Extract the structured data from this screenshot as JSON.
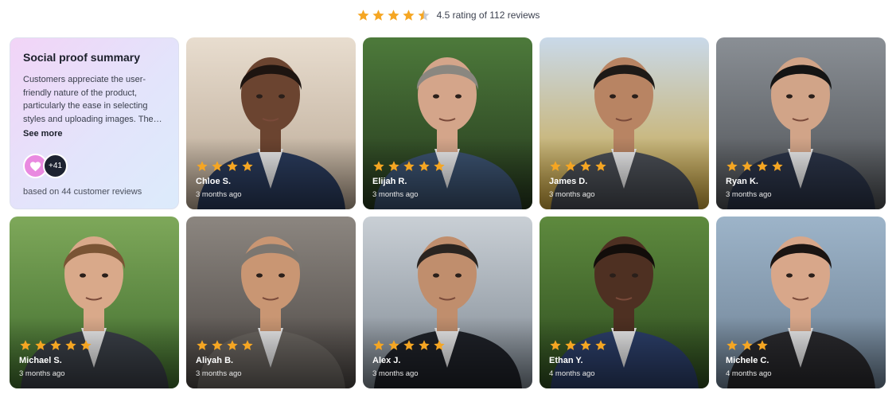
{
  "rating": {
    "stars": 4.5,
    "text": "4.5 rating of 112 reviews"
  },
  "summary": {
    "title": "Social proof summary",
    "body": "Customers appreciate the user-friendly nature of the product, particularly the ease in selecting styles and uploading images. The…",
    "see_more": "See more",
    "extra_count": "+41",
    "based_on": "based on 44 customer reviews"
  },
  "colors": {
    "star": "#f5a623",
    "accent_pink": "#e98ae0",
    "dark": "#1d2230"
  },
  "reviews": [
    {
      "name": "Chloe S.",
      "time": "3 months ago",
      "stars": 4,
      "bg": [
        "#e8ddcf",
        "#b7a591"
      ],
      "skin": "#6b4430",
      "suit": "#2a3b5c",
      "hair": "#1d1410"
    },
    {
      "name": "Elijah R.",
      "time": "3 months ago",
      "stars": 5,
      "bg": [
        "#4d7a3b",
        "#24361c"
      ],
      "skin": "#d4a58a",
      "suit": "#3b5270",
      "hair": "#8a8780"
    },
    {
      "name": "James D.",
      "time": "3 months ago",
      "stars": 4,
      "bg": [
        "#c9d9e9",
        "#c9a23a"
      ],
      "skin": "#b88463",
      "suit": "#4a4e55",
      "hair": "#1e1a17"
    },
    {
      "name": "Ryan K.",
      "time": "3 months ago",
      "stars": 4,
      "bg": [
        "#8a8f95",
        "#4c4f53"
      ],
      "skin": "#d1a488",
      "suit": "#2b3448",
      "hair": "#141414"
    },
    {
      "name": "Michael S.",
      "time": "3 months ago",
      "stars": 5,
      "bg": [
        "#7ea85a",
        "#3e6a2c"
      ],
      "skin": "#d9a98a",
      "suit": "#3b4048",
      "hair": "#7a5434"
    },
    {
      "name": "Aliyah B.",
      "time": "3 months ago",
      "stars": 4,
      "bg": [
        "#8c8680",
        "#4a4542"
      ],
      "skin": "#c99673",
      "suit": "#6b6661",
      "hair": "#7b7670"
    },
    {
      "name": "Alex J.",
      "time": "3 months ago",
      "stars": 5,
      "bg": [
        "#c9cfd5",
        "#7d8791"
      ],
      "skin": "#c08e6d",
      "suit": "#1f2229",
      "hair": "#2a2420"
    },
    {
      "name": "Ethan Y.",
      "time": "4 months ago",
      "stars": 4,
      "bg": [
        "#5e8a3e",
        "#2c4a1e"
      ],
      "skin": "#4e3022",
      "suit": "#2c3f6a",
      "hair": "#120d0a"
    },
    {
      "name": "Michele C.",
      "time": "4 months ago",
      "stars": 3,
      "bg": [
        "#9db4c9",
        "#6c7f92"
      ],
      "skin": "#d8a78a",
      "suit": "#2a2a2e",
      "hair": "#1a1412"
    }
  ]
}
